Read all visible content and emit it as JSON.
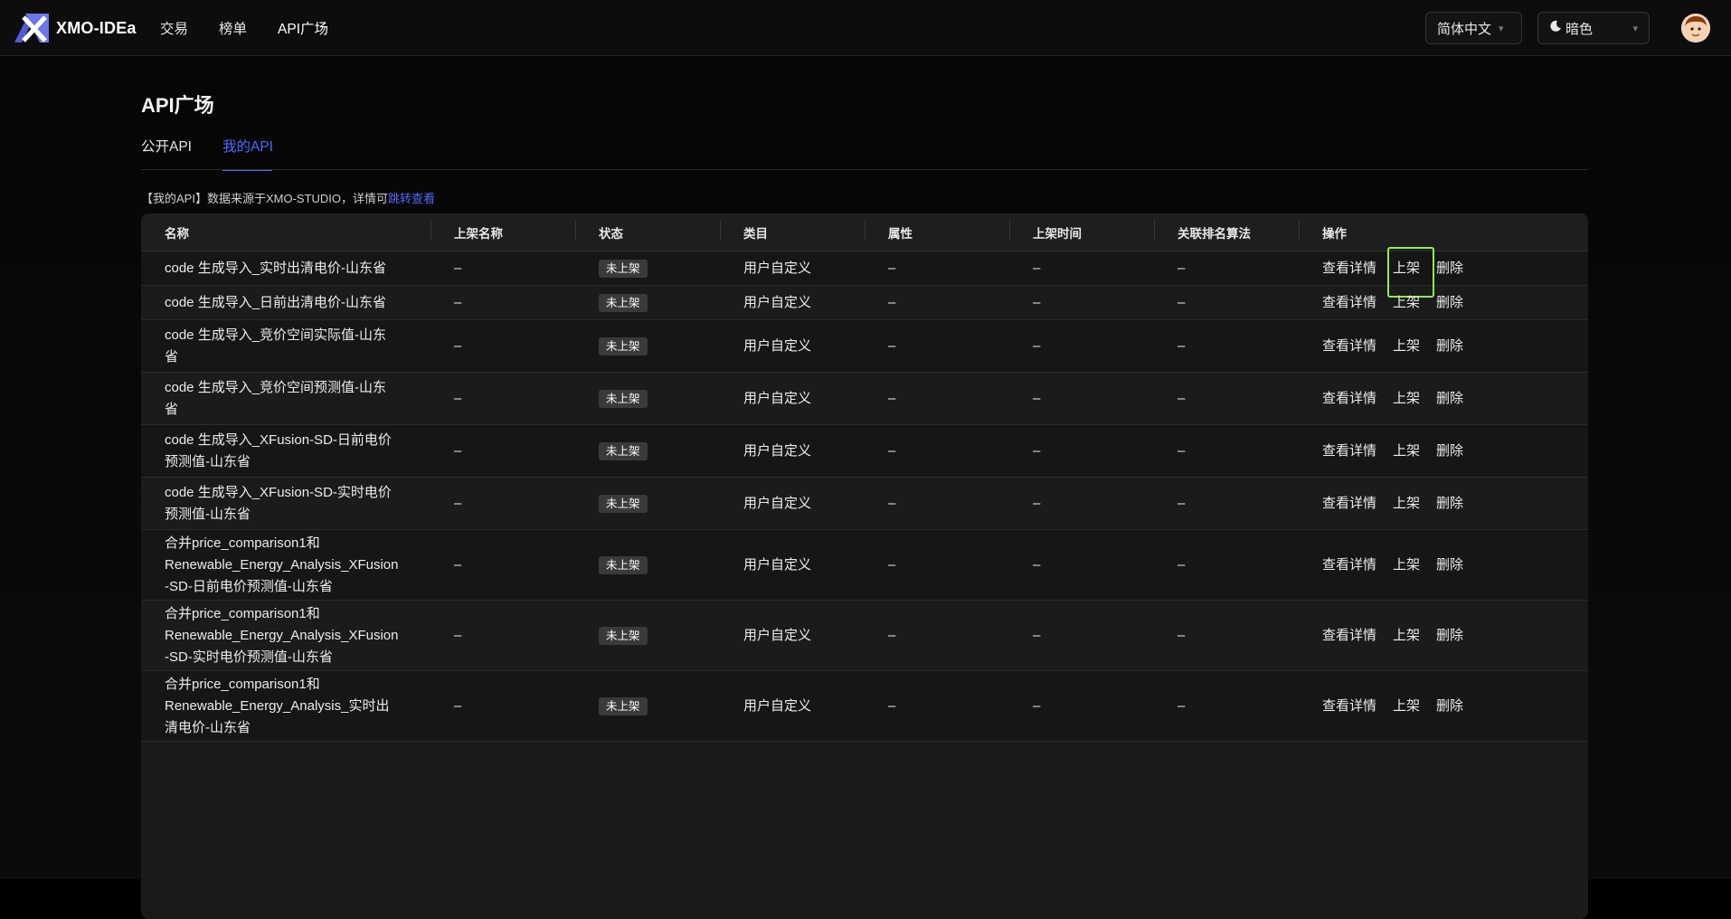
{
  "header": {
    "logo_text": "XMO-IDEa",
    "nav": [
      "交易",
      "榜单",
      "API广场"
    ],
    "language": "简体中文",
    "theme": "暗色"
  },
  "page": {
    "title": "API广场",
    "tabs": [
      "公开API",
      "我的API"
    ],
    "active_tab": "我的API",
    "notice_prefix": "【我的API】数据来源于XMO-STUDIO，详情可",
    "notice_link": "跳转查看"
  },
  "table": {
    "columns": [
      "名称",
      "上架名称",
      "状态",
      "类目",
      "属性",
      "上架时间",
      "关联排名算法",
      "操作"
    ],
    "actions": {
      "view": "查看详情",
      "publish": "上架",
      "delete": "删除"
    },
    "rows": [
      {
        "name": [
          "code 生成导入_实时出清电价-山东省"
        ],
        "listing_name": "–",
        "status": "未上架",
        "category": "用户自定义",
        "attribute": "–",
        "listing_time": "–",
        "ranking_algo": "–"
      },
      {
        "name": [
          "code 生成导入_日前出清电价-山东省"
        ],
        "listing_name": "–",
        "status": "未上架",
        "category": "用户自定义",
        "attribute": "–",
        "listing_time": "–",
        "ranking_algo": "–"
      },
      {
        "name": [
          "code 生成导入_竞价空间实际值-山东",
          "省"
        ],
        "listing_name": "–",
        "status": "未上架",
        "category": "用户自定义",
        "attribute": "–",
        "listing_time": "–",
        "ranking_algo": "–"
      },
      {
        "name": [
          "code 生成导入_竞价空间预测值-山东",
          "省"
        ],
        "listing_name": "–",
        "status": "未上架",
        "category": "用户自定义",
        "attribute": "–",
        "listing_time": "–",
        "ranking_algo": "–"
      },
      {
        "name": [
          "code 生成导入_XFusion-SD-日前电价",
          "预测值-山东省"
        ],
        "listing_name": "–",
        "status": "未上架",
        "category": "用户自定义",
        "attribute": "–",
        "listing_time": "–",
        "ranking_algo": "–"
      },
      {
        "name": [
          "code 生成导入_XFusion-SD-实时电价",
          "预测值-山东省"
        ],
        "listing_name": "–",
        "status": "未上架",
        "category": "用户自定义",
        "attribute": "–",
        "listing_time": "–",
        "ranking_algo": "–"
      },
      {
        "name": [
          "合并price_comparison1和",
          "Renewable_Energy_Analysis_XFusion",
          "-SD-日前电价预测值-山东省"
        ],
        "listing_name": "–",
        "status": "未上架",
        "category": "用户自定义",
        "attribute": "–",
        "listing_time": "–",
        "ranking_algo": "–"
      },
      {
        "name": [
          "合并price_comparison1和",
          "Renewable_Energy_Analysis_XFusion",
          "-SD-实时电价预测值-山东省"
        ],
        "listing_name": "–",
        "status": "未上架",
        "category": "用户自定义",
        "attribute": "–",
        "listing_time": "–",
        "ranking_algo": "–"
      },
      {
        "name": [
          "合并price_comparison1和",
          "Renewable_Energy_Analysis_实时出",
          "清电价-山东省"
        ],
        "listing_name": "–",
        "status": "未上架",
        "category": "用户自定义",
        "attribute": "–",
        "listing_time": "–",
        "ranking_algo": "–"
      }
    ]
  },
  "colors": {
    "accent": "#4f6bff",
    "highlight": "#8ef051"
  }
}
